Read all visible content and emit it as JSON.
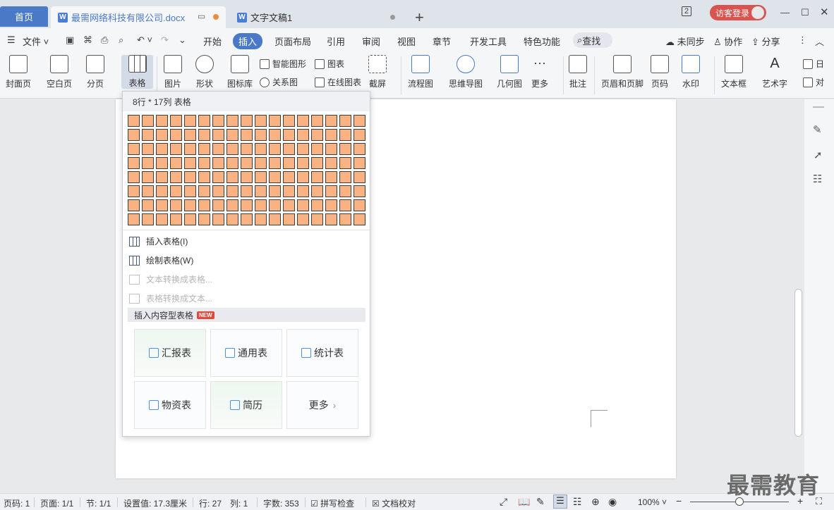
{
  "tabs": {
    "home": "首页",
    "doc1": "最需网络科技有限公司.docx",
    "doc2": "文字文稿1",
    "doc_icon": "W",
    "add": "+",
    "count_badge": "2",
    "login": "访客登录"
  },
  "menu": {
    "file": "文件",
    "items": [
      "开始",
      "插入",
      "页面布局",
      "引用",
      "审阅",
      "视图",
      "章节",
      "开发工具",
      "特色功能"
    ],
    "search": "查找",
    "sync": "未同步",
    "collab": "协作",
    "share": "分享"
  },
  "ribbon": {
    "cover": "封面页",
    "blank": "空白页",
    "pagebreak": "分页",
    "table": "表格",
    "picture": "图片",
    "shape": "形状",
    "iconlib": "图标库",
    "smartart": "智能图形",
    "chart": "图表",
    "relation": "关系图",
    "onlinechart": "在线图表",
    "screenshot": "截屏",
    "flow": "流程图",
    "mindmap": "思维导图",
    "geometry": "几何图",
    "more": "更多",
    "comment": "批注",
    "headerfooter": "页眉和页脚",
    "pagenum": "页码",
    "watermark": "水印",
    "textbox": "文本框",
    "wordart": "艺术字",
    "date": "日",
    "object": "对"
  },
  "dropdown": {
    "header": "8行 * 17列 表格",
    "grid_rows": 8,
    "grid_cols": 17,
    "insert_table": "插入表格(I)",
    "draw_table": "绘制表格(W)",
    "text_to_table": "文本转换成表格...",
    "table_to_text": "表格转换成文本...",
    "section": "插入内容型表格",
    "new_badge": "NEW",
    "cards": [
      "汇报表",
      "通用表",
      "统计表",
      "物资表",
      "简历",
      "更多"
    ],
    "more_chevron": "›"
  },
  "status": {
    "page": "页码: 1",
    "pages": "页面: 1/1",
    "section": "节: 1/1",
    "setting": "设置值: 17.3厘米",
    "row": "行: 27",
    "col": "列: 1",
    "words": "字数: 353",
    "spell": "拼写检查",
    "proof": "文档校对",
    "zoom": "100%",
    "zoom_minus": "−",
    "zoom_plus": "+"
  },
  "watermark_text": "最需教育",
  "colors": {
    "accent": "#4a79c8",
    "grid_cell": "#f9b382",
    "login": "#d9534f"
  }
}
